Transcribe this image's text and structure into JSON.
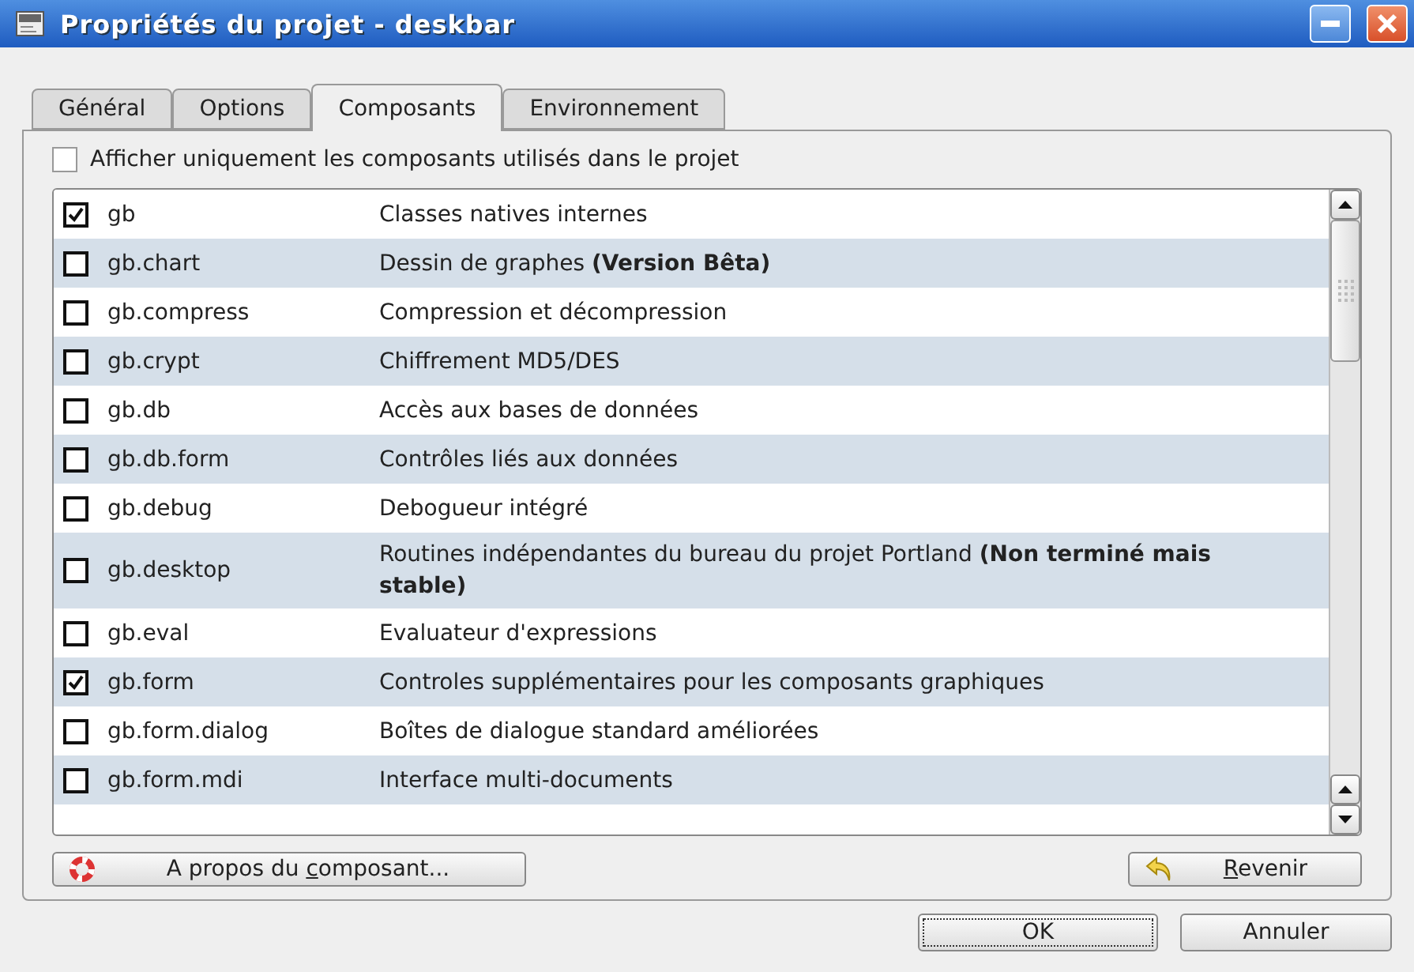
{
  "window": {
    "title": "Propriétés du projet - deskbar"
  },
  "tabs": [
    {
      "label": "Général",
      "selected": false
    },
    {
      "label": "Options",
      "selected": false
    },
    {
      "label": "Composants",
      "selected": true
    },
    {
      "label": "Environnement",
      "selected": false
    }
  ],
  "filter": {
    "label": "Afficher uniquement les composants utilisés dans le projet",
    "checked": false
  },
  "components": [
    {
      "name": "gb",
      "description": "Classes natives internes",
      "checked": true
    },
    {
      "name": "gb.chart",
      "description": "Dessin de graphes **(Version Bêta)**",
      "checked": false
    },
    {
      "name": "gb.compress",
      "description": "Compression et décompression",
      "checked": false
    },
    {
      "name": "gb.crypt",
      "description": "Chiffrement MD5/DES",
      "checked": false
    },
    {
      "name": "gb.db",
      "description": "Accès aux bases de données",
      "checked": false
    },
    {
      "name": "gb.db.form",
      "description": "Contrôles liés aux données",
      "checked": false
    },
    {
      "name": "gb.debug",
      "description": "Debogueur intégré",
      "checked": false
    },
    {
      "name": "gb.desktop",
      "description": "Routines indépendantes du bureau du projet Portland **(Non terminé mais stable)**",
      "checked": false
    },
    {
      "name": "gb.eval",
      "description": "Evaluateur d'expressions",
      "checked": false
    },
    {
      "name": "gb.form",
      "description": "Controles supplémentaires pour les composants graphiques",
      "checked": true
    },
    {
      "name": "gb.form.dialog",
      "description": "Boîtes de dialogue standard améliorées",
      "checked": false
    },
    {
      "name": "gb.form.mdi",
      "description": "Interface multi-documents",
      "checked": false
    }
  ],
  "about_button": {
    "before": "A propos du ",
    "mnemonic": "c",
    "after": "omposant..."
  },
  "revert_button": {
    "mnemonic": "R",
    "after": "evenir"
  },
  "buttons": [
    {
      "label": "OK",
      "default": true
    },
    {
      "label": "Annuler",
      "default": false
    }
  ]
}
